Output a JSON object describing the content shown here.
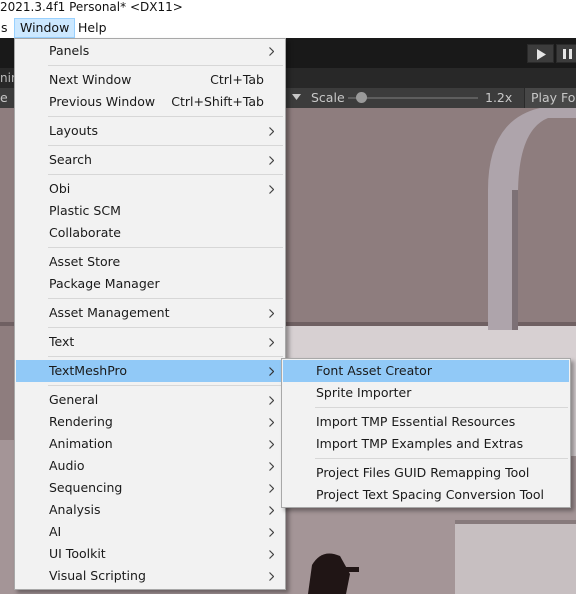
{
  "window_title": "2021.3.4f1 Personal* <DX11>",
  "menubar": {
    "items": [
      {
        "label": "s"
      },
      {
        "label": "Window",
        "active": true
      },
      {
        "label": "Help"
      }
    ]
  },
  "toolbar": {
    "tab_fragment": "nin"
  },
  "game_view": {
    "display_fragment": "e",
    "scale_label": "Scale",
    "scale_value": "1.2x",
    "scale_fraction": 0.1,
    "play_focus": "Play Focused"
  },
  "window_menu": {
    "items": [
      {
        "label": "Panels",
        "submenu": true
      },
      {
        "label": "Next Window",
        "shortcut": "Ctrl+Tab"
      },
      {
        "label": "Previous Window",
        "shortcut": "Ctrl+Shift+Tab"
      },
      {
        "label": "Layouts",
        "submenu": true
      },
      {
        "label": "Search",
        "submenu": true
      },
      {
        "label": "Obi",
        "submenu": true
      },
      {
        "label": "Plastic SCM"
      },
      {
        "label": "Collaborate"
      },
      {
        "label": "Asset Store"
      },
      {
        "label": "Package Manager"
      },
      {
        "label": "Asset Management",
        "submenu": true
      },
      {
        "label": "Text",
        "submenu": true
      },
      {
        "label": "TextMeshPro",
        "submenu": true,
        "highlighted": true
      },
      {
        "label": "General",
        "submenu": true
      },
      {
        "label": "Rendering",
        "submenu": true
      },
      {
        "label": "Animation",
        "submenu": true
      },
      {
        "label": "Audio",
        "submenu": true
      },
      {
        "label": "Sequencing",
        "submenu": true
      },
      {
        "label": "Analysis",
        "submenu": true
      },
      {
        "label": "AI",
        "submenu": true
      },
      {
        "label": "UI Toolkit",
        "submenu": true
      },
      {
        "label": "Visual Scripting",
        "submenu": true
      }
    ]
  },
  "textmeshpro_menu": {
    "items": [
      {
        "label": "Font Asset Creator",
        "highlighted": true
      },
      {
        "label": "Sprite Importer"
      },
      {
        "label": "Import TMP Essential Resources"
      },
      {
        "label": "Import TMP Examples and Extras"
      },
      {
        "label": "Project Files GUID Remapping Tool"
      },
      {
        "label": "Project Text Spacing Conversion Tool"
      }
    ]
  },
  "colors": {
    "menu_bg": "#f2f2f2",
    "menu_highlight": "#91c9f7",
    "unity_toolbar": "#191919",
    "viewport": "#8c7b7c"
  },
  "icons": {
    "play": "play-icon",
    "pause": "pause-icon",
    "submenu_arrow": "chevron-right-icon",
    "dropdown": "caret-down-icon"
  }
}
